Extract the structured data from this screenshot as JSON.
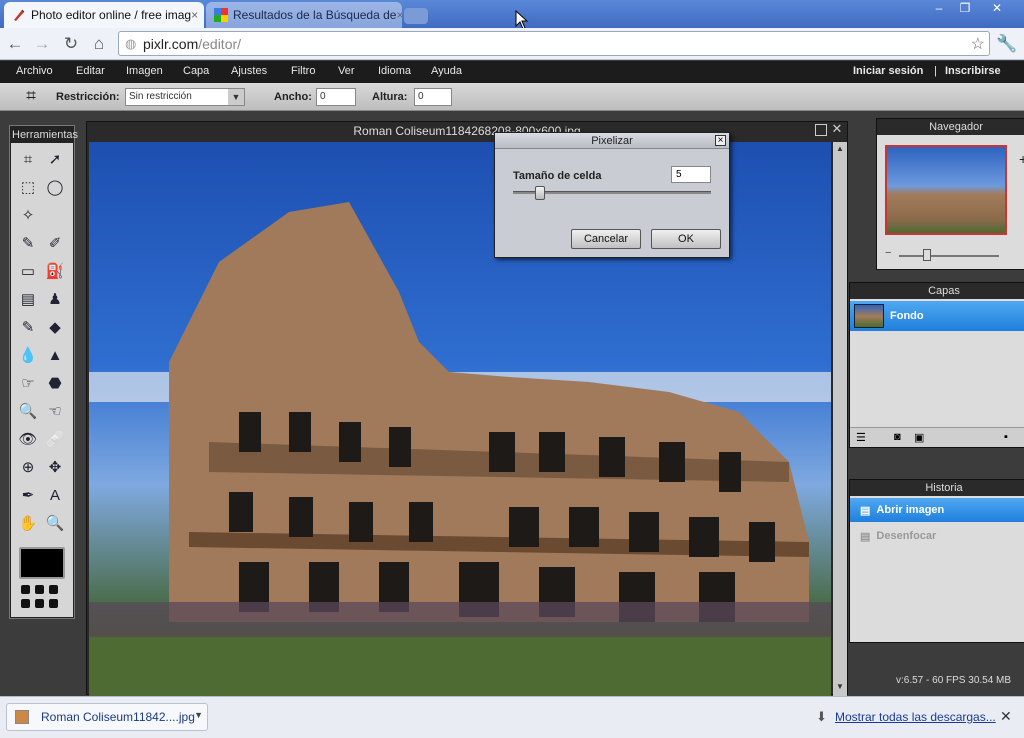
{
  "browser": {
    "tabs": [
      {
        "label": "Photo editor online / free imag",
        "close": "×",
        "active": true
      },
      {
        "label": "Resultados de la Búsqueda de",
        "close": "×",
        "active": false
      }
    ],
    "window_controls": [
      "–",
      "❐",
      "✕"
    ],
    "url_host": "pixlr.com",
    "url_path": "/editor/"
  },
  "menu": {
    "items": [
      "Archivo",
      "Editar",
      "Imagen",
      "Capa",
      "Ajustes",
      "Filtro",
      "Ver",
      "Idioma",
      "Ayuda"
    ],
    "login": "Iniciar sesión",
    "separator": "|",
    "signup": "Inscribirse"
  },
  "options": {
    "restriction_label": "Restricción:",
    "restriction_value": "Sin restricción",
    "width_label": "Ancho:",
    "width_value": "0",
    "height_label": "Altura:",
    "height_value": "0"
  },
  "tools": {
    "title": "Herramientas",
    "icons": [
      "crop-icon",
      "move-icon",
      "marquee-icon",
      "lasso-icon",
      "magic-wand-icon",
      "blank",
      "pencil-icon",
      "brush-icon",
      "eraser-icon",
      "paint-bucket-icon",
      "gradient-icon",
      "clone-stamp-icon",
      "color-replace-icon",
      "shape-icon",
      "blur-icon",
      "sharpen-icon",
      "smudge-icon",
      "sponge-icon",
      "burn-icon",
      "dodge-icon",
      "red-eye-icon",
      "spot-heal-icon",
      "bloat-icon",
      "pinch-icon",
      "eyedropper-icon",
      "text-icon",
      "hand-icon",
      "zoom-icon"
    ],
    "glyphs": [
      "⌗",
      "➚",
      "⬚",
      "◯",
      "✧",
      "",
      "✎",
      "✐",
      "▭",
      "⛽",
      "▤",
      "♟",
      "✎",
      "◆",
      "💧",
      "▲",
      "☞",
      "⬣",
      "🔍",
      "☜",
      "👁",
      "🩹",
      "⊕",
      "✥",
      "✒",
      "A",
      "✋",
      "🔍"
    ]
  },
  "canvas": {
    "title": "Roman Coliseum1184268208-800x600.jpg"
  },
  "dialog": {
    "title": "Pixelizar",
    "close": "×",
    "cell_size_label": "Tamaño de celda",
    "cell_size_value": "5",
    "slider_fraction": 0.1,
    "cancel": "Cancelar",
    "ok": "OK"
  },
  "navigator": {
    "title": "Navegador",
    "zoom_in": "+",
    "zoom_out": "−"
  },
  "layers": {
    "title": "Capas",
    "items": [
      {
        "name": "Fondo",
        "selected": true
      }
    ]
  },
  "history": {
    "title": "Historia",
    "items": [
      {
        "name": "Abrir imagen",
        "active": true
      },
      {
        "name": "Desenfocar",
        "active": false
      }
    ]
  },
  "status": "v:6.57 - 60 FPS 30.54 MB",
  "downloads": {
    "file": "Roman Coliseum11842....jpg",
    "show_all": "Mostrar todas las descargas...",
    "close": "✕"
  }
}
